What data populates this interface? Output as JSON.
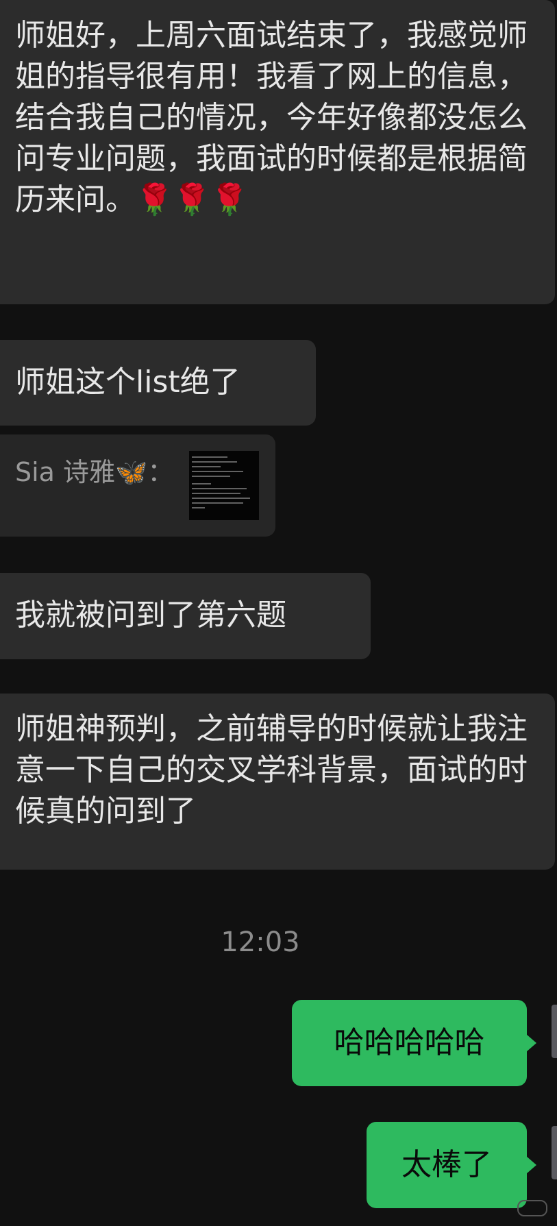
{
  "messages_in": [
    {
      "text": "师姐好，上周六面试结束了，我感觉师姐的指导很有用！我看了网上的信息，结合我自己的情况，今年好像都没怎么问专业问题，我面试的时候都是根据简历来问。",
      "emoji": "🌹🌹🌹"
    },
    {
      "text": "师姐这个list绝了"
    },
    {
      "text": "我就被问到了第六题"
    },
    {
      "text": "师姐神预判，之前辅导的时候就让我注意一下自己的交叉学科背景，面试的时候真的问到了"
    }
  ],
  "quote": {
    "sender": "Sia 诗雅",
    "emoji": "🦋",
    "separator": "："
  },
  "timestamp": "12:03",
  "messages_out": [
    {
      "text": "哈哈哈哈哈"
    },
    {
      "text": "太棒了"
    }
  ],
  "colors": {
    "background": "#111111",
    "incoming_bubble": "#2c2c2c",
    "outgoing_bubble": "#2eba5f"
  }
}
